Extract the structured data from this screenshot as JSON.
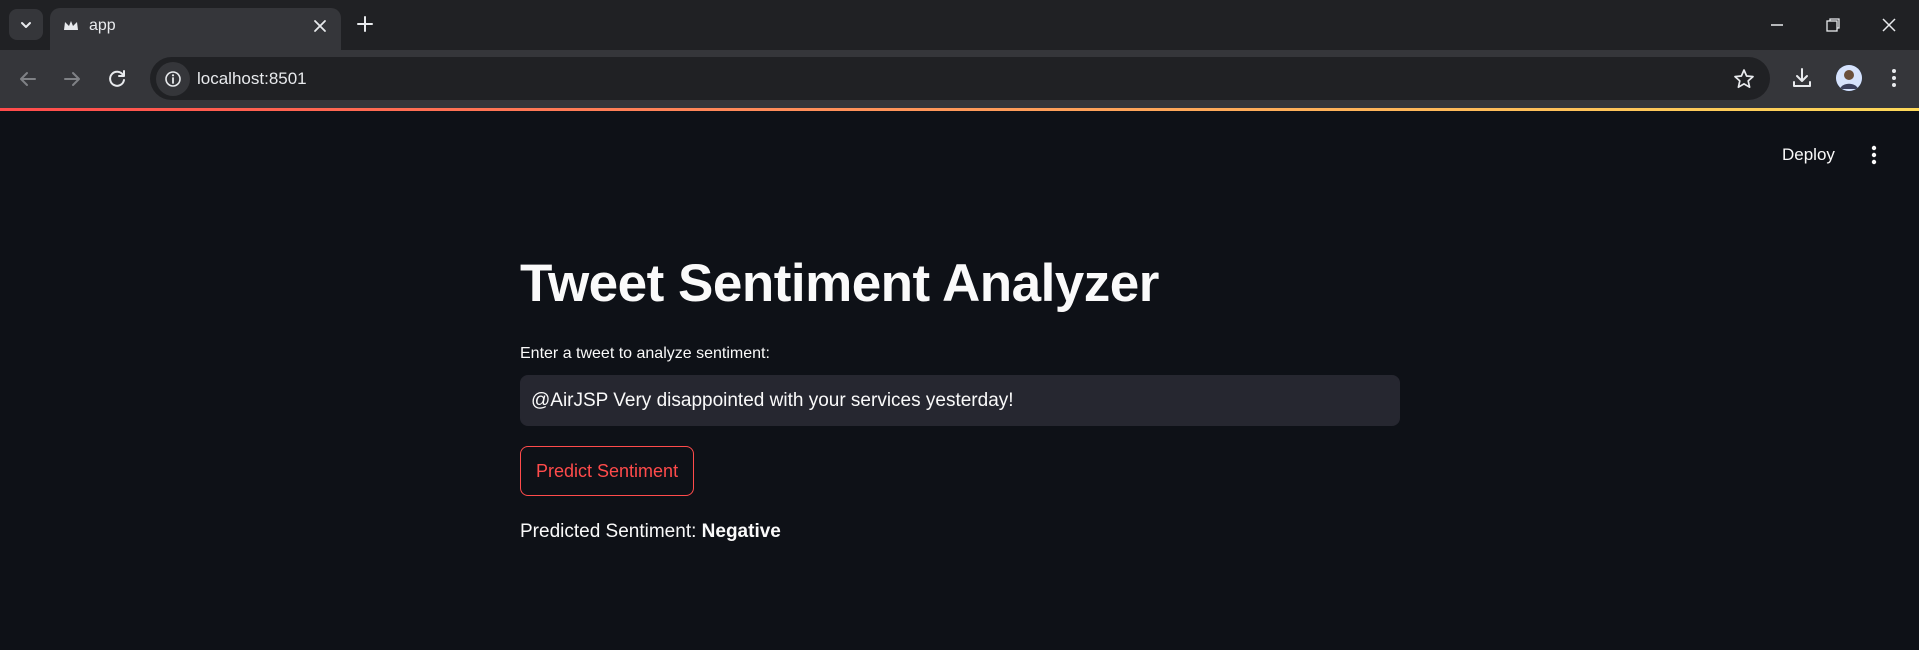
{
  "browser": {
    "tab": {
      "title": "app"
    },
    "address_bar": {
      "url": "localhost:8501"
    },
    "colors": {
      "tabbar_bg": "#202124",
      "toolbar_bg": "#35363a",
      "omnibox_bg": "#202124"
    }
  },
  "header": {
    "deploy_label": "Deploy"
  },
  "main": {
    "title": "Tweet Sentiment Analyzer",
    "input": {
      "label": "Enter a tweet to analyze sentiment:",
      "value": "@AirJSP Very disappointed with your services yesterday!"
    },
    "predict_button_label": "Predict Sentiment",
    "result": {
      "prefix": "Predicted Sentiment:",
      "value": "Negative"
    }
  },
  "theme": {
    "app_bg": "#0e1117",
    "text": "#fafafa",
    "input_bg": "#262730",
    "primary": "#ff4b4b"
  },
  "icons": [
    "tab-search-icon",
    "streamlit-favicon-icon",
    "close-icon",
    "plus-icon",
    "minimize-icon",
    "restore-icon",
    "window-close-icon",
    "back-arrow-icon",
    "forward-arrow-icon",
    "reload-icon",
    "site-info-icon",
    "star-icon",
    "download-icon",
    "profile-avatar",
    "browser-menu-icon",
    "app-menu-icon"
  ]
}
